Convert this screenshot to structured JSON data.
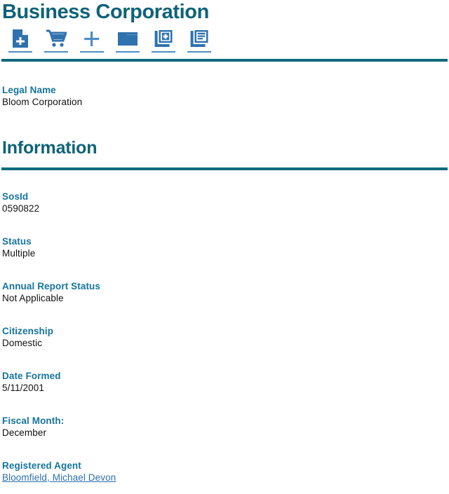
{
  "header": {
    "title": "Business Corporation"
  },
  "toolbar": {
    "buttons": [
      {
        "name": "new-filing-icon",
        "label": "new-filing",
        "icon": "document-plus-icon"
      },
      {
        "name": "shopping-cart-icon",
        "label": "shopping-cart",
        "icon": "cart-icon"
      },
      {
        "name": "add-icon",
        "label": "add",
        "icon": "plus-icon"
      },
      {
        "name": "folder-icon",
        "label": "folder",
        "icon": "folder-icon"
      },
      {
        "name": "add-document-icon",
        "label": "add-document",
        "icon": "copy-plus-icon"
      },
      {
        "name": "document-list-icon",
        "label": "document-list",
        "icon": "documents-list-icon"
      }
    ]
  },
  "legal_name": {
    "label": "Legal Name",
    "value": "Bloom Corporation"
  },
  "information": {
    "heading": "Information",
    "fields": [
      {
        "label": "SosId",
        "value": "0590822"
      },
      {
        "label": "Status",
        "value": "Multiple"
      },
      {
        "label": "Annual Report Status",
        "value": "Not Applicable"
      },
      {
        "label": "Citizenship",
        "value": "Domestic"
      },
      {
        "label": "Date Formed",
        "value": "5/11/2001"
      },
      {
        "label": "Fiscal Month:",
        "value": "December"
      },
      {
        "label": "Registered Agent",
        "value": "Bloomfield, Michael Devon",
        "is_link": true
      }
    ]
  },
  "colors": {
    "heading_teal": "#0f6278",
    "label_teal": "#15749e",
    "divider_teal": "#0f6a7d",
    "icon_blue": "#2f72ad",
    "link_blue": "#2a6fad",
    "text_black": "#111111"
  }
}
